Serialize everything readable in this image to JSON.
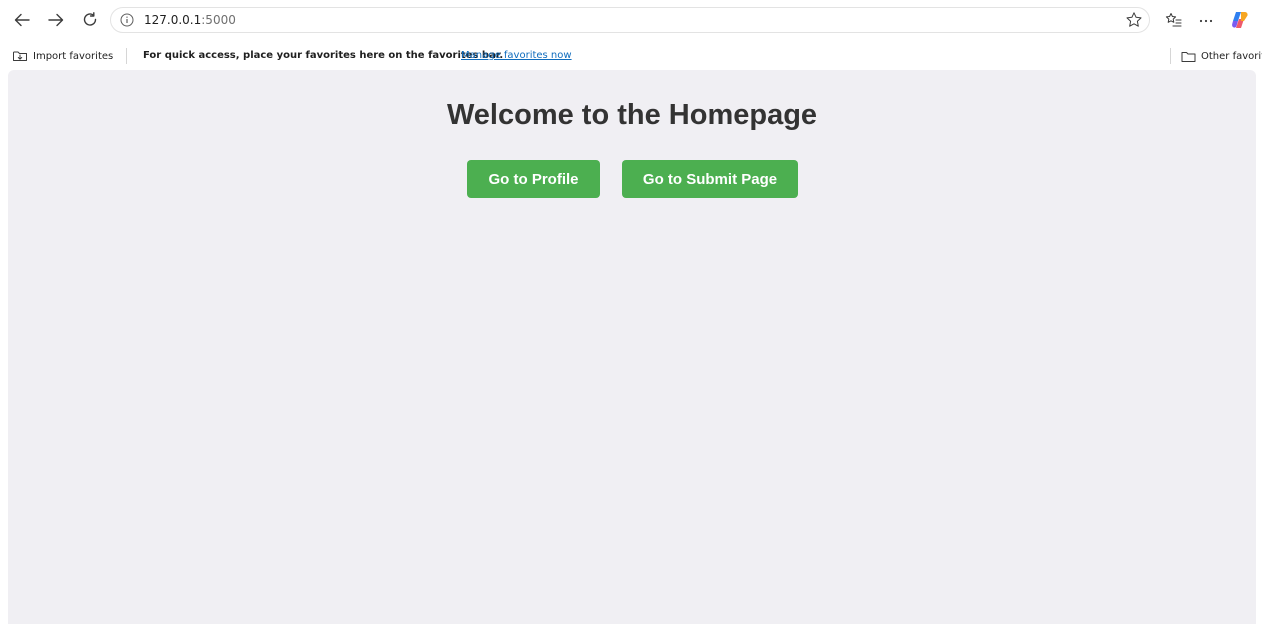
{
  "browser": {
    "url_host": "127.0.0.1",
    "url_port": ":5000",
    "icons": {
      "back": "back-arrow-icon",
      "forward": "forward-arrow-icon",
      "refresh": "refresh-icon",
      "info": "info-icon",
      "favorite": "star-icon",
      "favorites_list": "favorites-list-icon",
      "more": "more-icon",
      "copilot": "copilot-icon"
    }
  },
  "favorites_bar": {
    "import_label": "Import favorites",
    "hint": "For quick access, place your favorites here on the favorites bar.",
    "manage_link": "Manage favorites now",
    "other_label": "Other favorites"
  },
  "page": {
    "title": "Welcome to the Homepage",
    "buttons": [
      {
        "label": "Go to Profile"
      },
      {
        "label": "Go to Submit Page"
      }
    ]
  },
  "colors": {
    "button_bg": "#4caf50",
    "page_bg": "#f0eff3",
    "title_color": "#333333",
    "link_color": "#0f6cbd"
  }
}
